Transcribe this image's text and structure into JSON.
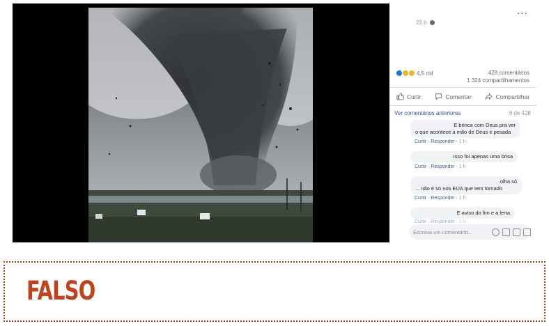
{
  "post": {
    "timestamp": "22 h",
    "more_label": "···",
    "reactions_count": "4,5 mil",
    "comments_count": "428 comentários",
    "shares_count": "1 324 compartilhamentos",
    "actions": {
      "like": "Curtir",
      "comment": "Comentar",
      "share": "Compartilhar"
    },
    "previous_comments": "Ver comentários anteriores",
    "page_count": "6 de 428",
    "comments": [
      {
        "lines": [
          "E brinca com Deus pra ver",
          "o que acontece a mão de Deus e pesada"
        ],
        "like": "Curtir",
        "reply": "Responder",
        "time": "1 h"
      },
      {
        "lines": [
          "Isso foi apenas uma brisa"
        ],
        "like": "Curtir",
        "reply": "Responder",
        "time": "1 h"
      },
      {
        "lines": [
          "olha só",
          "... não é só nos EUA que tem tornado"
        ],
        "like": "Curtir",
        "reply": "Responder",
        "time": "1 h"
      },
      {
        "lines": [
          "E aviso do fim e a lerta"
        ],
        "like": "Curtir",
        "reply": "Responder",
        "time": "1 h"
      }
    ],
    "comment_placeholder": "Escreva um comentário..."
  },
  "verdict": "FALSO",
  "colors": {
    "verdict": "#c0421f",
    "link": "#385898"
  }
}
